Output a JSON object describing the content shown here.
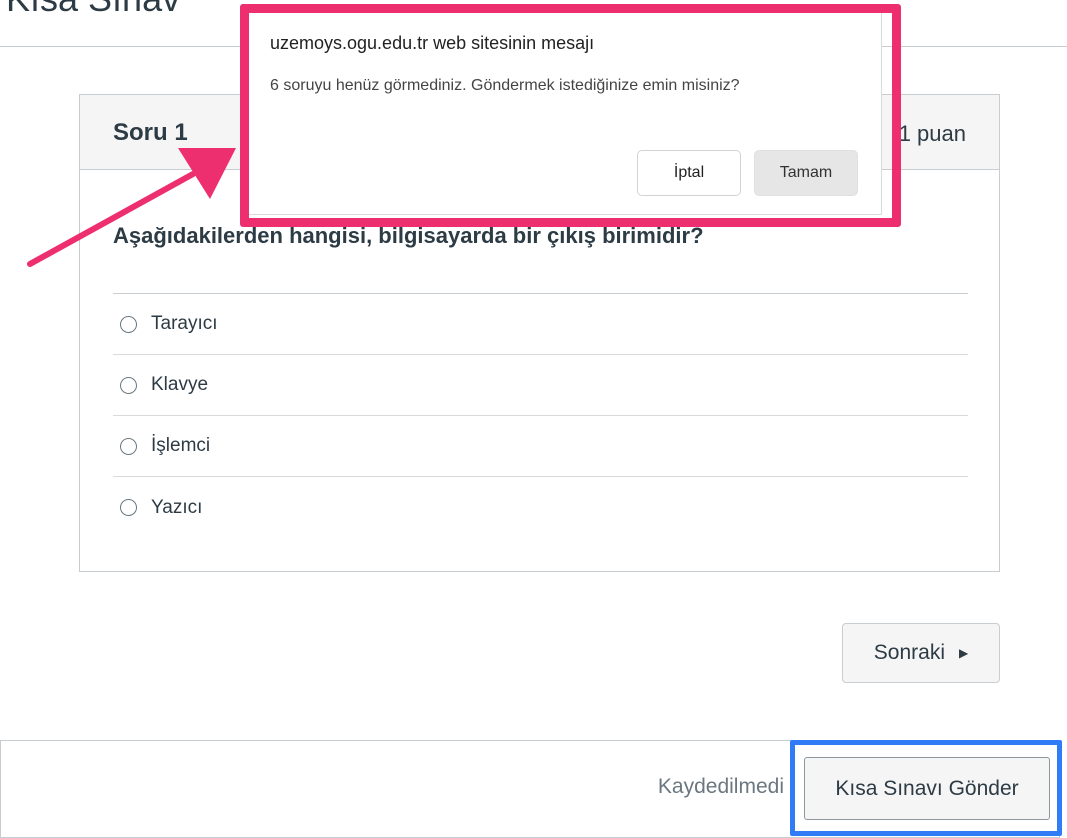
{
  "page": {
    "title_partial": "Kısa Sınav"
  },
  "question": {
    "number_label": "Soru 1",
    "points_label": "1 puan",
    "text": "Aşağıdakilerden hangisi, bilgisayarda bir çıkış birimidir?",
    "answers": [
      {
        "label": "Tarayıcı"
      },
      {
        "label": "Klavye"
      },
      {
        "label": "İşlemci"
      },
      {
        "label": "Yazıcı"
      }
    ]
  },
  "navigation": {
    "next_label": "Sonraki",
    "next_icon": "caret-right-icon"
  },
  "footer": {
    "save_status": "Kaydedilmedi",
    "submit_label": "Kısa Sınavı Gönder"
  },
  "dialog": {
    "title": "uzemoys.ogu.edu.tr web sitesinin mesajı",
    "message": "6 soruyu henüz görmediniz. Göndermek istediğinize emin misiniz?",
    "cancel_label": "İptal",
    "ok_label": "Tamam"
  },
  "annotations": {
    "highlight_color_pink": "#ee2f6f",
    "highlight_color_blue": "#2f7cf6"
  }
}
